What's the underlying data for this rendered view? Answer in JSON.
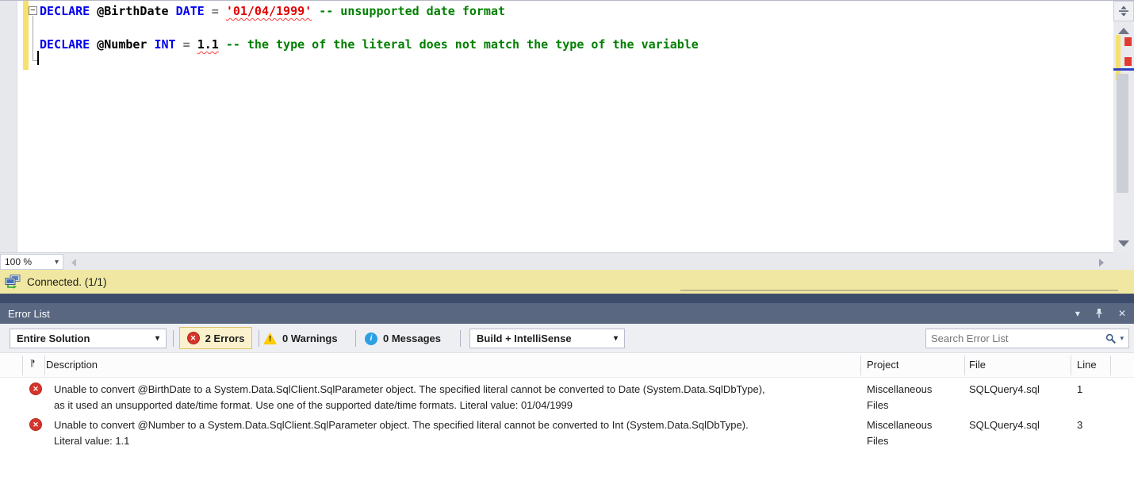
{
  "colors": {
    "kw": "#0000ee",
    "var": "#000000",
    "op": "#6e6e6e",
    "str": "#e00000",
    "com": "#008000",
    "num": "#000000",
    "status-bg": "#f0e8a2",
    "title-bg": "#5a6781",
    "strip-bg": "#3e4c6b",
    "toolbar-bg": "#edeff3",
    "error-red": "#d6352c",
    "warn-yellow": "#ffcc00",
    "info-blue": "#2ba0e3",
    "change-yellow": "#f5e070",
    "errbtn-bg": "#fbf2cd",
    "errbtn-border": "#dfc263"
  },
  "icons": {
    "error_glyph": "✕",
    "warning_glyph": "!",
    "info_glyph": "i",
    "chevron_down": "▾",
    "close_glyph": "✕",
    "fold_minus": "−",
    "category_glyph": "¶"
  },
  "editor": {
    "zoom_level": "100 %",
    "status_text": "Connected. (1/1)",
    "lines": [
      {
        "tokens": [
          {
            "t": "DECLARE",
            "c": "kw"
          },
          {
            "t": " "
          },
          {
            "t": "@BirthDate",
            "c": "var"
          },
          {
            "t": " "
          },
          {
            "t": "DATE",
            "c": "kw"
          },
          {
            "t": " "
          },
          {
            "t": "=",
            "c": "op"
          },
          {
            "t": " "
          },
          {
            "t": "'01/04/1999'",
            "c": "str err"
          },
          {
            "t": " "
          },
          {
            "t": "-- unsupported date format",
            "c": "com"
          }
        ]
      },
      {
        "tokens": [
          {
            "t": "DECLARE",
            "c": "kw"
          },
          {
            "t": " "
          },
          {
            "t": "@Number",
            "c": "var"
          },
          {
            "t": " "
          },
          {
            "t": "INT",
            "c": "kw"
          },
          {
            "t": " "
          },
          {
            "t": "=",
            "c": "op"
          },
          {
            "t": " "
          },
          {
            "t": "1.1",
            "c": "num err"
          },
          {
            "t": " "
          },
          {
            "t": "-- the type of the literal does not match the type of the variable",
            "c": "com"
          }
        ]
      }
    ]
  },
  "error_list": {
    "title": "Error List",
    "toolbar": {
      "scope": "Entire Solution",
      "errors_label": "2 Errors",
      "warnings_label": "0 Warnings",
      "messages_label": "0 Messages",
      "filter": "Build + IntelliSense",
      "search_placeholder": "Search Error List"
    },
    "columns": [
      "Description",
      "Project",
      "File",
      "Line"
    ],
    "rows": [
      {
        "description": "Unable to convert @BirthDate to a System.Data.SqlClient.SqlParameter object. The specified literal cannot be converted to Date (System.Data.SqlDbType), as it used an unsupported date/time format. Use one of the supported date/time formats. Literal value: 01/04/1999",
        "project": "Miscellaneous Files",
        "file": "SQLQuery4.sql",
        "line": "1"
      },
      {
        "description": "Unable to convert @Number to a System.Data.SqlClient.SqlParameter object. The specified literal cannot be converted to Int (System.Data.SqlDbType). Literal value: 1.1",
        "project": "Miscellaneous Files",
        "file": "SQLQuery4.sql",
        "line": "3"
      }
    ]
  }
}
